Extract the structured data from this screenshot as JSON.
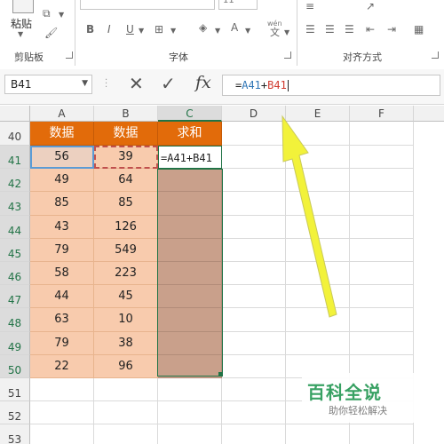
{
  "ribbon": {
    "paste_label": "粘贴",
    "font_size_value": "11",
    "wen_label": "wén",
    "groups": {
      "clipboard": "剪贴板",
      "font": "字体",
      "alignment": "对齐方式"
    }
  },
  "formula_bar": {
    "name_box": "B41",
    "formula_prefix": "=",
    "ref1": "A41",
    "operator": "+",
    "ref2": "B41",
    "ref1_color": "#2e75b6",
    "ref2_color": "#d03a2e"
  },
  "sheet": {
    "columns": [
      "A",
      "B",
      "C",
      "D",
      "E",
      "F"
    ],
    "selected_column": "C",
    "header_row": {
      "row": "40",
      "a": "数据",
      "b": "数据",
      "c": "求和"
    },
    "rows": [
      {
        "num": "41",
        "a": "56",
        "b": "39",
        "c": "=A41+B41"
      },
      {
        "num": "42",
        "a": "49",
        "b": "64",
        "c": ""
      },
      {
        "num": "43",
        "a": "85",
        "b": "85",
        "c": ""
      },
      {
        "num": "44",
        "a": "43",
        "b": "126",
        "c": ""
      },
      {
        "num": "45",
        "a": "79",
        "b": "549",
        "c": ""
      },
      {
        "num": "46",
        "a": "58",
        "b": "223",
        "c": ""
      },
      {
        "num": "47",
        "a": "44",
        "b": "45",
        "c": ""
      },
      {
        "num": "48",
        "a": "63",
        "b": "10",
        "c": ""
      },
      {
        "num": "49",
        "a": "79",
        "b": "38",
        "c": ""
      },
      {
        "num": "50",
        "a": "22",
        "b": "96",
        "c": ""
      }
    ],
    "empty_rows": [
      "51",
      "52",
      "53"
    ]
  },
  "colors": {
    "header_fill": "#e26b0a",
    "data_fill": "#f8cbad",
    "sum_fill": "#c9a08b",
    "accent": "#217346",
    "arrow": "#f2f23a"
  },
  "watermark": {
    "title": "百科全说",
    "subtitle": "助你轻松解决"
  }
}
